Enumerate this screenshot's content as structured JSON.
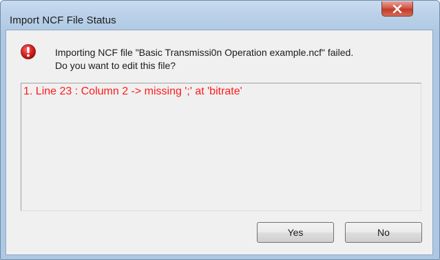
{
  "window": {
    "title": "Import NCF File Status",
    "close_icon": "close-icon"
  },
  "dialog": {
    "icon": "error-icon",
    "message_line1": "Importing NCF file \"Basic Transmissi0n Operation example.ncf\" failed.",
    "message_line2": "Do you want to edit this file?",
    "details": [
      "1. Line 23 : Column 2 -> missing ';' at 'bitrate'"
    ],
    "details_color": "#ff1a1a"
  },
  "buttons": {
    "yes_label": "Yes",
    "no_label": "No"
  }
}
